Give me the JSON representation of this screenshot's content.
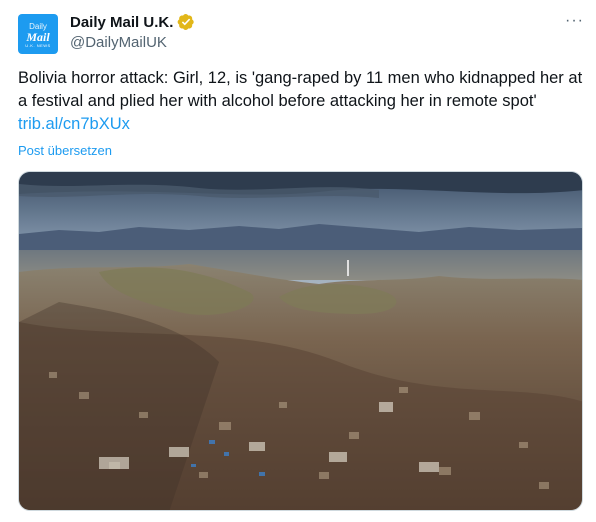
{
  "tweet": {
    "avatar": {
      "line1": "Daily",
      "line2": "Mail",
      "line3": "U.K. NEWS"
    },
    "display_name": "Daily Mail U.K.",
    "handle": "@DailyMailUK",
    "more_label": "···",
    "text": "Bolivia horror attack: Girl, 12, is 'gang-raped by 11 men who kidnapped her at a festival and plied her with alcohol before attacking her in remote spot' ",
    "link": "trib.al/cn7bXUx",
    "translate_label": "Post übersetzen",
    "verified_badge_color": "#e2b719",
    "accent_color": "#1d9bf0"
  },
  "media": {
    "description_icon": "city-landscape-photo"
  }
}
